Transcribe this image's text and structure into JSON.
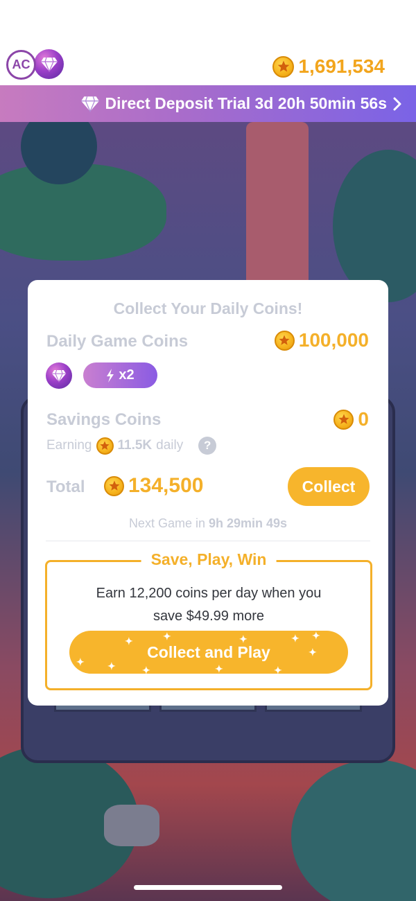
{
  "header": {
    "avatar_initials": "AC",
    "coin_balance": "1,691,534"
  },
  "trial_banner": {
    "text": "Direct Deposit Trial 3d 20h 50min 56s"
  },
  "modal": {
    "title": "Collect Your Daily Coins!",
    "daily": {
      "label": "Daily Game Coins",
      "amount": "100,000",
      "boost": "x2"
    },
    "savings": {
      "label": "Savings Coins",
      "amount": "0",
      "earning_prefix": "Earning",
      "earning_amount": "11.5K",
      "earning_suffix": "daily"
    },
    "total": {
      "label": "Total",
      "amount": "134,500"
    },
    "collect_label": "Collect",
    "next_game_prefix": "Next Game in",
    "next_game_time": "9h 29min 49s",
    "promo": {
      "title": "Save, Play, Win",
      "line1": "Earn 12,200 coins per day when you",
      "line2": "save $49.99 more",
      "button_label": "Collect and Play"
    }
  },
  "colors": {
    "accent_gold": "#f4b02a",
    "purple": "#8b45a8",
    "muted_text": "#c7cbd6"
  },
  "icons": [
    "gem-icon",
    "coin-icon",
    "chevron-right-icon",
    "lightning-icon",
    "help-icon"
  ]
}
